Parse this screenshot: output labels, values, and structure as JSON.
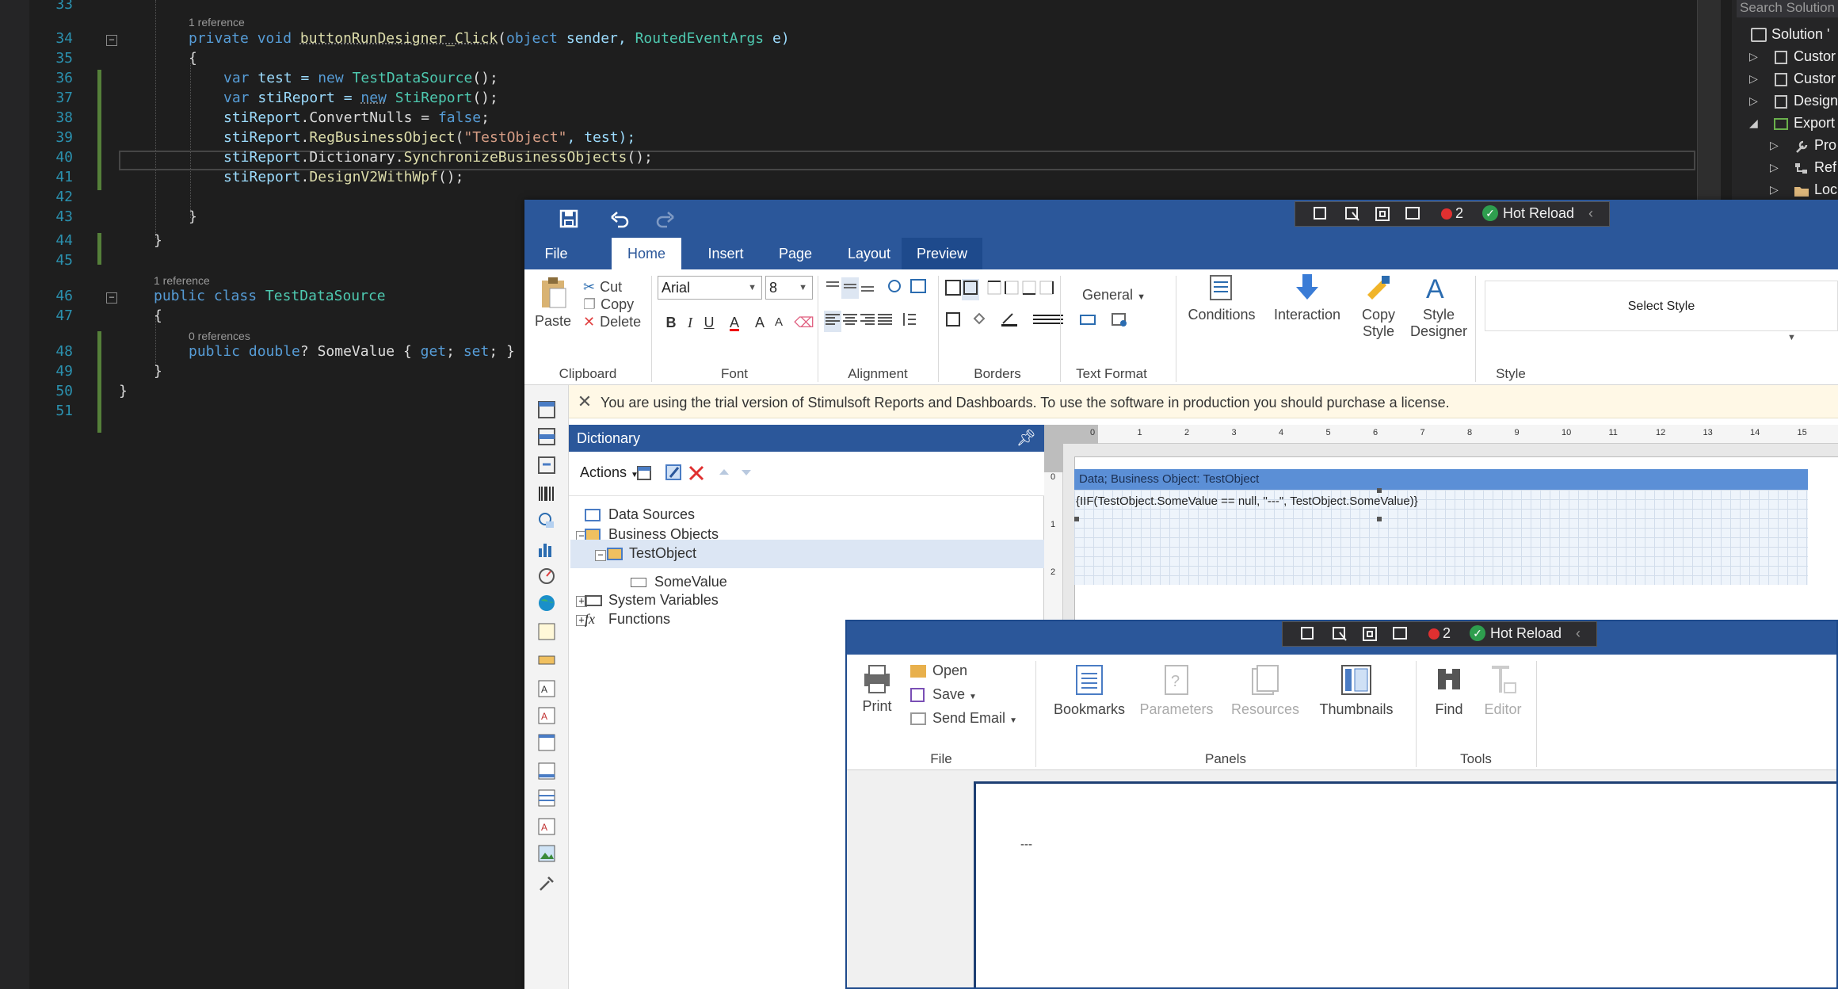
{
  "editor": {
    "lines": [
      {
        "n": "33"
      },
      {
        "n": "34",
        "lens": "1 reference"
      },
      {
        "n": "35"
      },
      {
        "n": "36"
      },
      {
        "n": "37"
      },
      {
        "n": "38"
      },
      {
        "n": "39"
      },
      {
        "n": "40"
      },
      {
        "n": "41"
      },
      {
        "n": "42"
      },
      {
        "n": "43"
      },
      {
        "n": "44"
      },
      {
        "n": "45"
      },
      {
        "n": "46",
        "lens": "1 reference"
      },
      {
        "n": "47"
      },
      {
        "n": "48",
        "lens": "0 references"
      },
      {
        "n": "49"
      },
      {
        "n": "50"
      },
      {
        "n": "51"
      }
    ],
    "tokens": {
      "l34": [
        "private",
        " ",
        "void",
        " ",
        "buttonRunDesigner_Click",
        "(",
        "object",
        " sender, ",
        "RoutedEventArgs",
        " e)"
      ],
      "l35": "{",
      "l36": [
        "var",
        " test = ",
        "new",
        " ",
        "TestDataSource",
        "();"
      ],
      "l37": [
        "var",
        " stiReport = ",
        "new",
        " ",
        "StiReport",
        "();"
      ],
      "l38": [
        "stiReport",
        ".ConvertNulls = ",
        "false",
        ";"
      ],
      "l39": [
        "stiReport",
        ".",
        "RegBusinessObject",
        "(",
        "\"TestObject\"",
        ", test);"
      ],
      "l40": [
        "stiReport",
        ".Dictionary.",
        "SynchronizeBusinessObjects",
        "();"
      ],
      "l41": [
        "stiReport",
        ".",
        "DesignV2WithWpf",
        "();"
      ],
      "l43": "}",
      "l44": "}",
      "l46": [
        "public",
        " ",
        "class",
        " ",
        "TestDataSource"
      ],
      "l47": "{",
      "l48": [
        "public",
        " ",
        "double",
        "? SomeValue { ",
        "get",
        "; ",
        "set",
        "; }"
      ],
      "l49": "}",
      "l50": "}"
    }
  },
  "solution_explorer": {
    "search_placeholder": "Search Solution",
    "items": [
      "Solution '",
      "Custor",
      "Custor",
      "Design",
      "Export",
      "Pro",
      "Ref",
      "Loc"
    ]
  },
  "designer": {
    "tabs": [
      "File",
      "Home",
      "Insert",
      "Page",
      "Layout",
      "Preview"
    ],
    "active_tab": "Home",
    "clipboard": {
      "paste": "Paste",
      "cut": "Cut",
      "copy": "Copy",
      "delete": "Delete",
      "group": "Clipboard"
    },
    "font": {
      "family": "Arial",
      "size": "8",
      "bold": "B",
      "italic": "I",
      "underline": "U",
      "color": "A",
      "grow": "A",
      "shrink": "A",
      "group": "Font"
    },
    "groups": {
      "alignment": "Alignment",
      "borders": "Borders",
      "text_format": "Text Format",
      "style": "Style"
    },
    "text_format": {
      "format": "General"
    },
    "style_buttons": {
      "conditions": "Conditions",
      "interaction": "Interaction",
      "copy_style_1": "Copy",
      "copy_style_2": "Style",
      "style_designer_1": "Style",
      "style_designer_2": "Designer",
      "select_style": "Select Style"
    },
    "trial_message": "You are using the trial version of Stimulsoft Reports and Dashboards. To use the software in production you should purchase a license.",
    "dictionary": {
      "title": "Dictionary",
      "actions": "Actions",
      "tree": [
        "Data Sources",
        "Business Objects",
        "TestObject",
        "SomeValue",
        "System Variables",
        "Functions"
      ],
      "expanders": {
        "minus": "−",
        "plus": "+"
      }
    },
    "ruler_h": [
      "0",
      "1",
      "2",
      "3",
      "4",
      "5",
      "6",
      "7",
      "8",
      "9",
      "10",
      "11",
      "12",
      "13",
      "14",
      "15"
    ],
    "ruler_v": [
      "0",
      "1",
      "2"
    ],
    "band_title": "Data; Business Object: TestObject",
    "band_expression": "{IIF(TestObject.SomeValue == null, \"---\", TestObject.SomeValue)}"
  },
  "preview": {
    "print": "Print",
    "open": "Open",
    "save": "Save",
    "send_email": "Send Email",
    "bookmarks": "Bookmarks",
    "parameters": "Parameters",
    "resources": "Resources",
    "thumbnails": "Thumbnails",
    "find": "Find",
    "editor": "Editor",
    "groups": {
      "file": "File",
      "panels": "Panels",
      "tools": "Tools"
    },
    "page_text": "---"
  },
  "hot_reload": {
    "label": "Hot Reload",
    "count": "2"
  },
  "colors": {
    "accent": "#2b579a",
    "editor_bg": "#1e1e1e",
    "keyword": "#569cd6",
    "type": "#4ec9b0",
    "string": "#d69d85",
    "method": "#dcdcaa"
  }
}
